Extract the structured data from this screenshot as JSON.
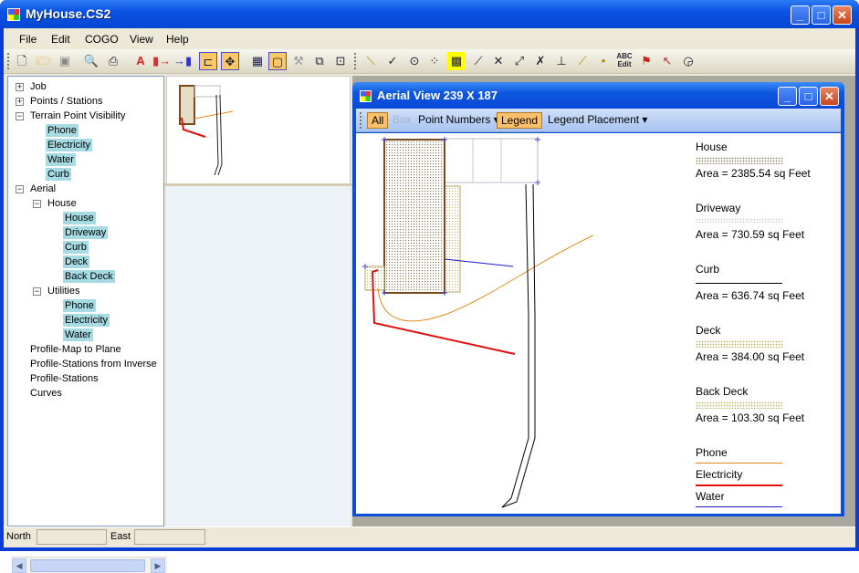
{
  "app": {
    "title": "MyHouse.CS2"
  },
  "menu": [
    "File",
    "Edit",
    "COGO",
    "View",
    "Help"
  ],
  "tree": {
    "nodes": [
      {
        "label": "Job",
        "expander": "+"
      },
      {
        "label": "Points / Stations",
        "expander": "+"
      },
      {
        "label": "Terrain Point Visibility",
        "expander": "−"
      },
      {
        "label": "Phone"
      },
      {
        "label": "Electricity"
      },
      {
        "label": "Water"
      },
      {
        "label": "Curb"
      },
      {
        "label": "Aerial",
        "expander": "−"
      },
      {
        "label": "House",
        "expander": "−"
      },
      {
        "label": "House"
      },
      {
        "label": "Driveway"
      },
      {
        "label": "Curb"
      },
      {
        "label": "Deck"
      },
      {
        "label": "Back Deck"
      },
      {
        "label": "Utilities",
        "expander": "−"
      },
      {
        "label": "Phone"
      },
      {
        "label": "Electricity"
      },
      {
        "label": "Water"
      },
      {
        "label": "Profile-Map to Plane"
      },
      {
        "label": "Profile-Stations from Inverse"
      },
      {
        "label": "Profile-Stations"
      },
      {
        "label": "Curves"
      }
    ]
  },
  "child_window": {
    "title": "Aerial View   239  X  187",
    "toolbar": {
      "all": "All",
      "box": "Box",
      "point_numbers": "Point Numbers",
      "legend": "Legend",
      "legend_placement": "Legend Placement"
    }
  },
  "legend": {
    "areas": [
      {
        "name": "House",
        "area": "Area = 2385.54 sq Feet"
      },
      {
        "name": "Driveway",
        "area": "Area = 730.59 sq Feet"
      },
      {
        "name": "Curb",
        "area": "Area = 636.74 sq Feet"
      },
      {
        "name": "Deck",
        "area": "Area = 384.00 sq Feet"
      },
      {
        "name": "Back Deck",
        "area": "Area = 103.30 sq Feet"
      }
    ],
    "lines": [
      {
        "name": "Phone",
        "color": "#e08a1e"
      },
      {
        "name": "Electricity",
        "color": "#e01010"
      },
      {
        "name": "Water",
        "color": "#1a1ad0"
      }
    ]
  },
  "status": {
    "north_label": "North",
    "east_label": "East"
  },
  "icons": {
    "min": "minimize-icon",
    "max": "maximize-icon",
    "close": "close-icon"
  }
}
